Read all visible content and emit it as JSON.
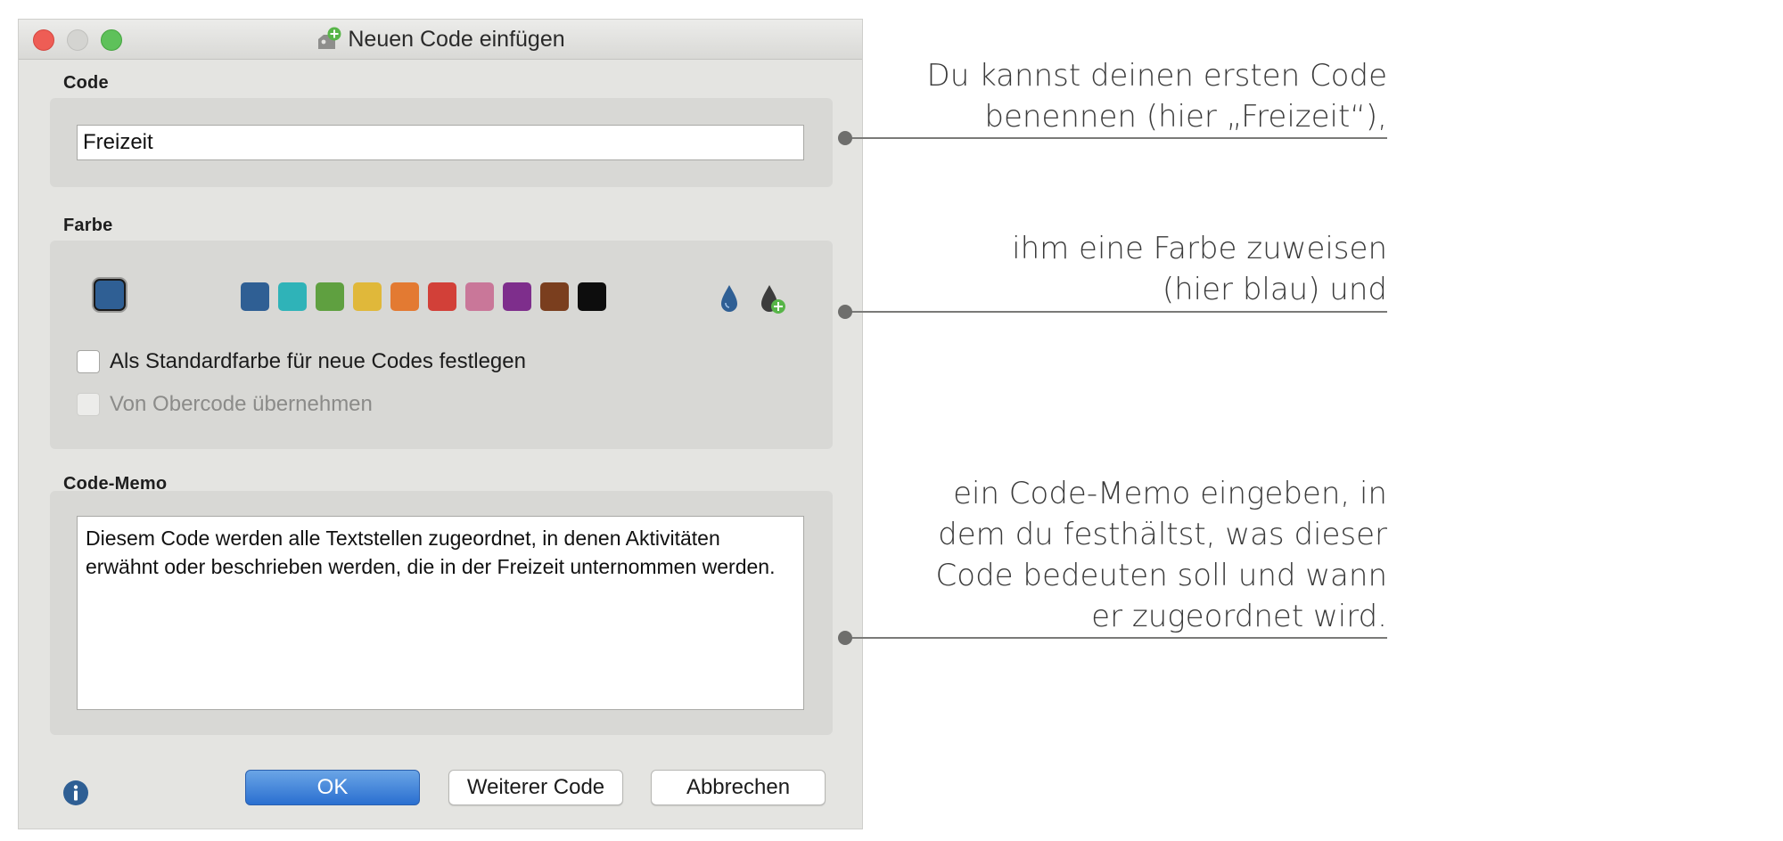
{
  "window": {
    "title": "Neuen Code einfügen",
    "title_icon": "add-code-icon"
  },
  "code_section": {
    "label": "Code",
    "value": "Freizeit"
  },
  "color_section": {
    "label": "Farbe",
    "current_color": "#2f5f94",
    "swatches": [
      "#2f5f94",
      "#2fb3b8",
      "#5fa040",
      "#e0b83a",
      "#e37a32",
      "#d24038",
      "#c97799",
      "#7e2e8c",
      "#7a3e1e",
      "#0d0d0d"
    ],
    "droplet_icon": "water-drop-icon",
    "add_color_icon": "add-color-drop-icon",
    "default_checkbox_label": "Als Standardfarbe für neue Codes festlegen",
    "inherit_checkbox_label": "Von Obercode übernehmen"
  },
  "memo_section": {
    "label": "Code-Memo",
    "value": "Diesem Code werden alle Textstellen zugeordnet, in denen Aktivitäten erwähnt oder beschrieben werden, die in der Freizeit unternommen werden."
  },
  "footer": {
    "info_icon": "info-icon",
    "ok_label": "OK",
    "next_label": "Weiterer Code",
    "cancel_label": "Abbrechen"
  },
  "annotations": [
    {
      "lines": [
        "Du kannst deinen ersten Code",
        "benennen (hier „Freizeit“),"
      ]
    },
    {
      "lines": [
        "ihm eine Farbe zuweisen",
        "(hier blau) und"
      ]
    },
    {
      "lines": [
        "ein Code-Memo eingeben, in",
        "dem du festhältst, was dieser",
        "Code bedeuten soll und wann",
        "er zugeordnet wird."
      ]
    }
  ]
}
